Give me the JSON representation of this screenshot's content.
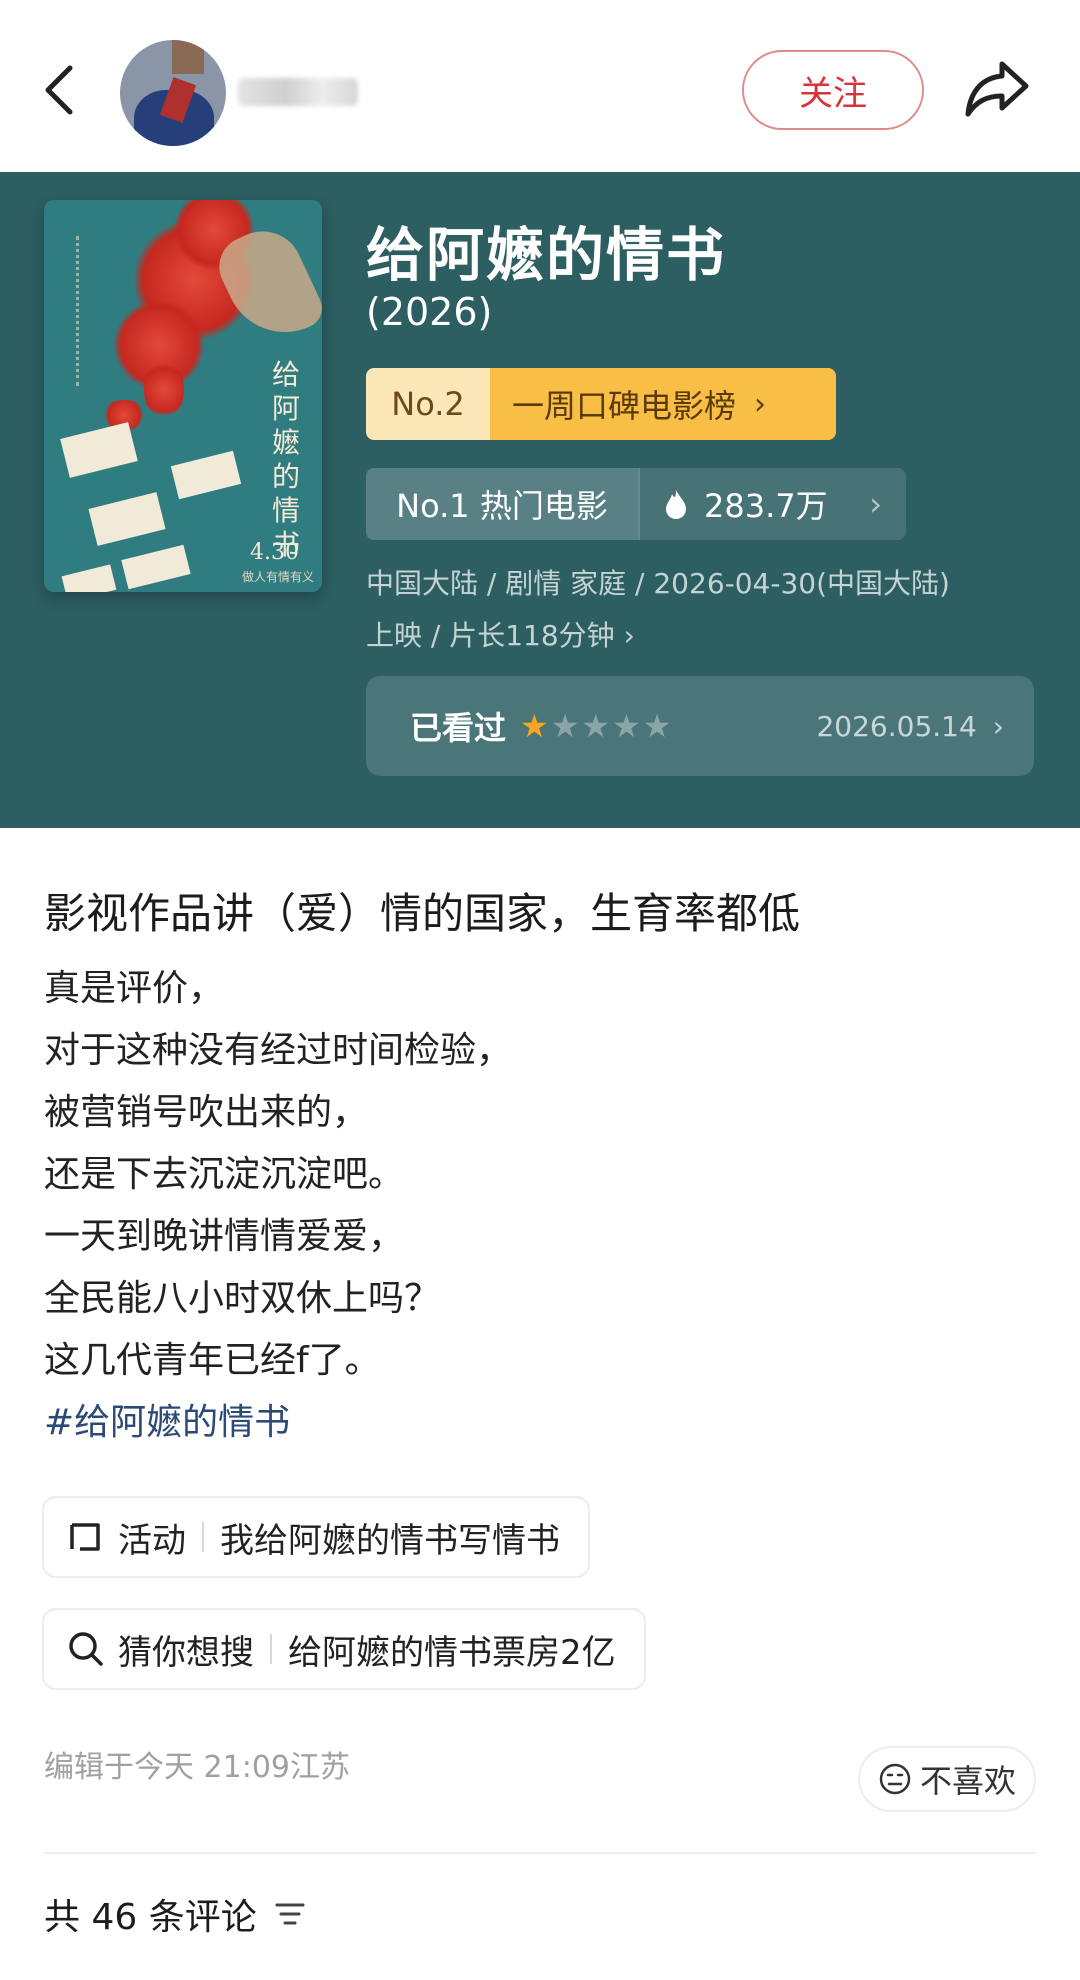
{
  "header": {
    "follow_label": "关注"
  },
  "movie": {
    "title": "给阿嬷的情书",
    "year": "(2026)",
    "rank_no": "No.2",
    "rank_list": "一周口碑电影榜",
    "hot_label": "No.1 热门电影",
    "hot_value": "283.7万",
    "meta_line1": "中国大陆 / 剧情 家庭 / 2026-04-30(中国大陆)",
    "meta_line2": "上映 / 片长118分钟",
    "watched_label": "已看过",
    "rating": 1,
    "rating_max": 5,
    "watched_date": "2026.05.14",
    "poster": {
      "vertical_title": "给阿嬷的情书",
      "date": "4.30",
      "slogan": "做人有情有义"
    }
  },
  "post": {
    "title": "影视作品讲（爱）情的国家，生育率都低",
    "lines": [
      "真是评价，",
      "对于这种没有经过时间检验，",
      "被营销号吹出来的，",
      "还是下去沉淀沉淀吧。",
      "一天到晚讲情情爱爱，",
      "全民能八小时双休上吗？",
      "这几代青年已经f了。"
    ],
    "hashtag": "#给阿嬷的情书"
  },
  "chips": {
    "activity": {
      "tag": "活动",
      "text": "我给阿嬷的情书写情书"
    },
    "search": {
      "tag": "猜你想搜",
      "text": "给阿嬷的情书票房2亿"
    }
  },
  "footer": {
    "edit_info": "编辑于今天 21:09江苏",
    "dislike_label": "不喜欢",
    "comments": "共 46 条评论"
  },
  "colors": {
    "card_bg": "#2c5e62",
    "follow_red": "#d8323a",
    "rank_gold": "#f8be45",
    "star_active": "#f5a623",
    "hashtag": "#2b4a78"
  },
  "icons": [
    "back-arrow-icon",
    "share-arrow-icon",
    "flame-icon",
    "chevron-right-icon",
    "star-icon",
    "activity-icon",
    "search-icon",
    "dislike-face-icon",
    "filter-icon"
  ]
}
